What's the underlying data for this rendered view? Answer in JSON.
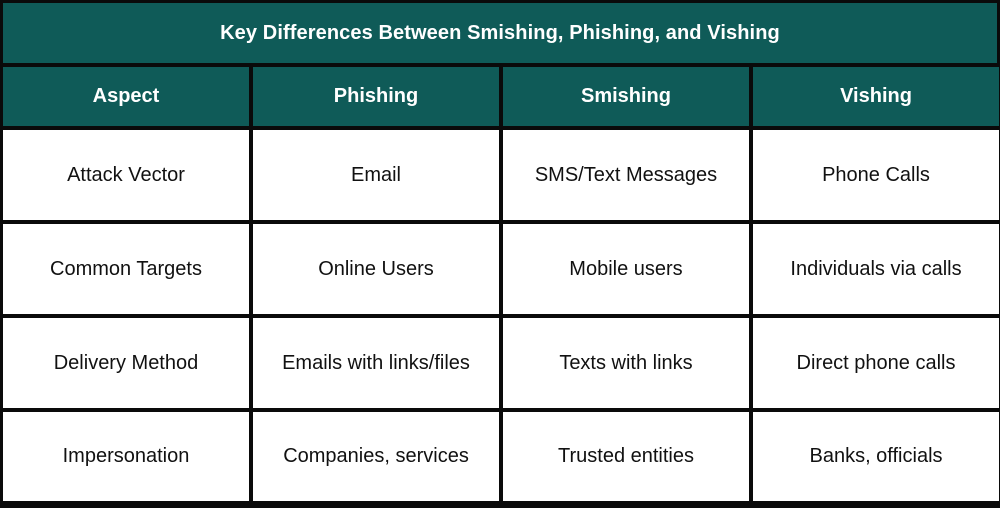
{
  "table": {
    "title": "Key Differences Between Smishing, Phishing, and Vishing",
    "colors": {
      "header_bg": "#0f5b58",
      "header_text": "#ffffff",
      "border": "#0a0a0a",
      "cell_bg": "#ffffff"
    },
    "headers": [
      "Aspect",
      "Phishing",
      "Smishing",
      "Vishing"
    ],
    "rows": [
      [
        "Attack Vector",
        "Email",
        "SMS/Text Messages",
        "Phone Calls"
      ],
      [
        "Common Targets",
        "Online Users",
        "Mobile users",
        "Individuals via calls"
      ],
      [
        "Delivery Method",
        "Emails with links/files",
        "Texts with links",
        "Direct phone calls"
      ],
      [
        "Impersonation",
        "Companies, services",
        "Trusted entities",
        "Banks, officials"
      ]
    ]
  }
}
